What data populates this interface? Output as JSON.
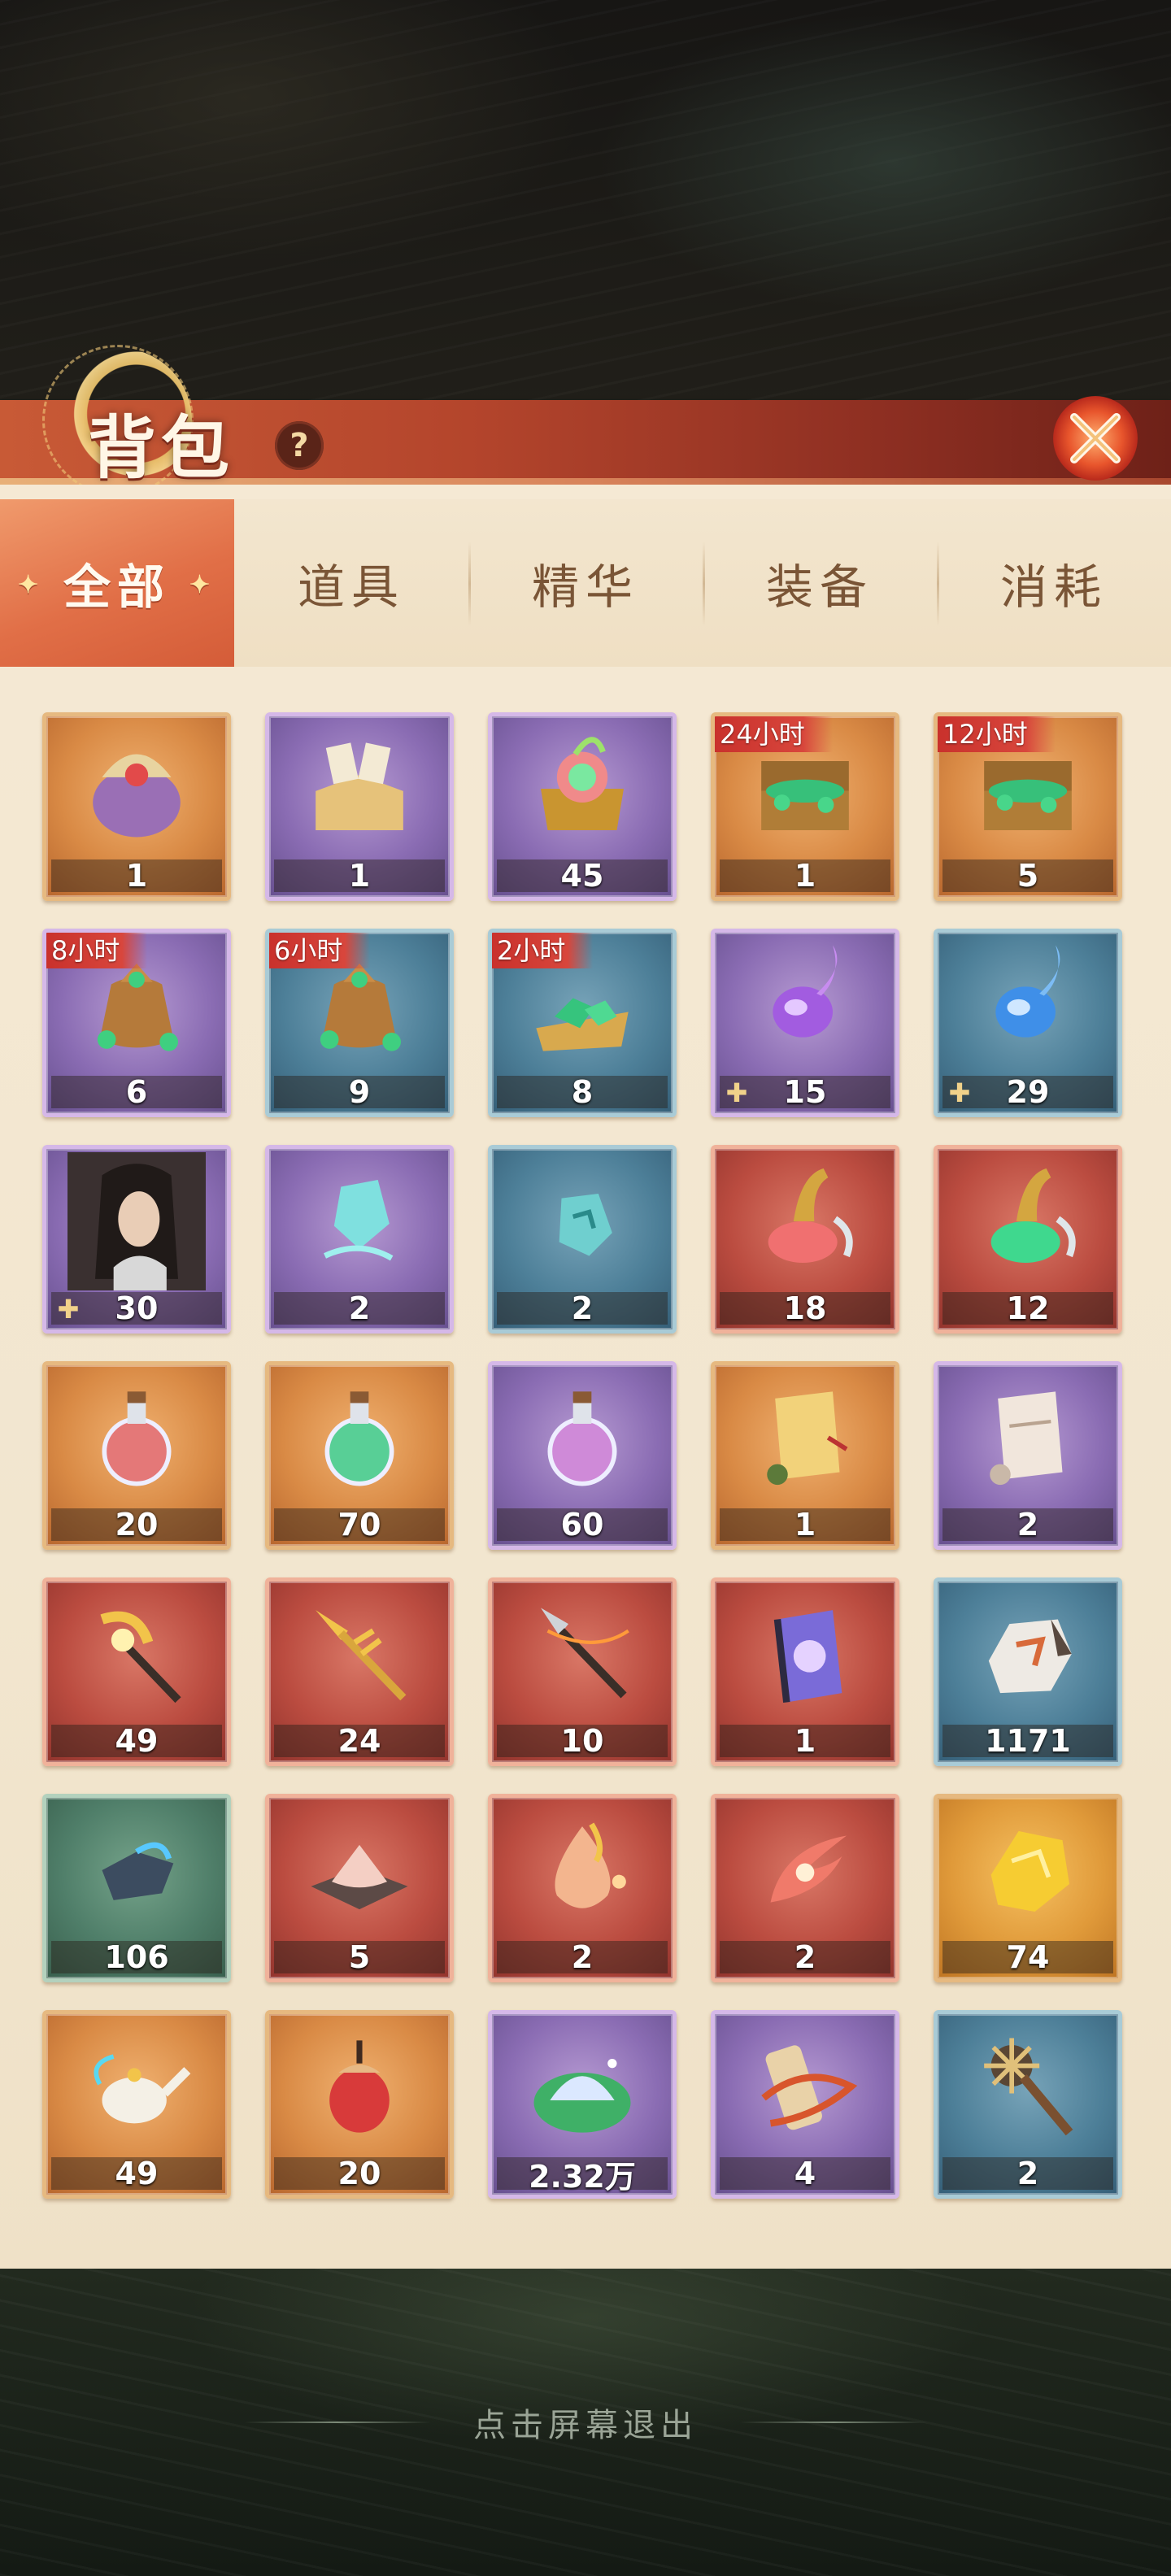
{
  "header": {
    "title": "背包",
    "help_icon": "?",
    "close_icon": "close-icon"
  },
  "tabs": [
    {
      "label": "全部",
      "active": true
    },
    {
      "label": "道具",
      "active": false
    },
    {
      "label": "精华",
      "active": false
    },
    {
      "label": "装备",
      "active": false
    },
    {
      "label": "消耗",
      "active": false
    }
  ],
  "items": [
    {
      "icon": "gift-bag-icon",
      "quality": "orange",
      "count": "1",
      "timer": ""
    },
    {
      "icon": "open-box-icon",
      "quality": "purple",
      "count": "1",
      "timer": ""
    },
    {
      "icon": "glowing-chest-icon",
      "quality": "purple",
      "count": "45",
      "timer": ""
    },
    {
      "icon": "jade-treasure-chest-icon",
      "quality": "orange",
      "count": "1",
      "timer": "24小时"
    },
    {
      "icon": "jade-treasure-chest-icon",
      "quality": "orange",
      "count": "5",
      "timer": "12小时"
    },
    {
      "icon": "jade-money-bag-icon",
      "quality": "purple",
      "count": "6",
      "timer": "8小时"
    },
    {
      "icon": "jade-money-bag-icon",
      "quality": "blue",
      "count": "9",
      "timer": "6小时"
    },
    {
      "icon": "jade-pile-icon",
      "quality": "blue",
      "count": "8",
      "timer": "2小时"
    },
    {
      "icon": "purple-soul-flame-icon",
      "quality": "purple",
      "count": "15",
      "timer": "",
      "fragment": true
    },
    {
      "icon": "blue-soul-flame-icon",
      "quality": "blue",
      "count": "29",
      "timer": "",
      "fragment": true
    },
    {
      "icon": "character-portrait-icon",
      "quality": "purple",
      "count": "30",
      "timer": "",
      "fragment": true
    },
    {
      "icon": "cyan-crystal-icon",
      "quality": "purple",
      "count": "2",
      "timer": ""
    },
    {
      "icon": "cyan-stone-icon",
      "quality": "blue",
      "count": "2",
      "timer": ""
    },
    {
      "icon": "red-elixir-gourd-icon",
      "quality": "red",
      "count": "18",
      "timer": ""
    },
    {
      "icon": "green-elixir-gourd-icon",
      "quality": "red",
      "count": "12",
      "timer": ""
    },
    {
      "icon": "red-potion-icon",
      "quality": "orange",
      "count": "20",
      "timer": ""
    },
    {
      "icon": "green-potion-icon",
      "quality": "orange",
      "count": "70",
      "timer": ""
    },
    {
      "icon": "purple-potion-icon",
      "quality": "purple",
      "count": "60",
      "timer": ""
    },
    {
      "icon": "golden-scroll-icon",
      "quality": "orange",
      "count": "1",
      "timer": ""
    },
    {
      "icon": "silver-scroll-icon",
      "quality": "purple",
      "count": "2",
      "timer": ""
    },
    {
      "icon": "golden-crescent-spear-icon",
      "quality": "red",
      "count": "49",
      "timer": ""
    },
    {
      "icon": "golden-halberd-icon",
      "quality": "red",
      "count": "24",
      "timer": ""
    },
    {
      "icon": "dark-spear-icon",
      "quality": "red",
      "count": "10",
      "timer": ""
    },
    {
      "icon": "lotus-talisman-icon",
      "quality": "red",
      "count": "1",
      "timer": ""
    },
    {
      "icon": "ore-stone-icon",
      "quality": "blue",
      "count": "1171",
      "timer": ""
    },
    {
      "icon": "dark-gem-icon",
      "quality": "green",
      "count": "106",
      "timer": ""
    },
    {
      "icon": "salt-tray-icon",
      "quality": "red",
      "count": "5",
      "timer": ""
    },
    {
      "icon": "flame-drop-icon",
      "quality": "red",
      "count": "2",
      "timer": ""
    },
    {
      "icon": "phoenix-feather-icon",
      "quality": "red",
      "count": "2",
      "timer": ""
    },
    {
      "icon": "gold-ore-icon",
      "quality": "gold",
      "count": "74",
      "timer": ""
    },
    {
      "icon": "magic-teapot-icon",
      "quality": "orange",
      "count": "49",
      "timer": ""
    },
    {
      "icon": "red-flower-bud-icon",
      "quality": "orange",
      "count": "20",
      "timer": ""
    },
    {
      "icon": "crystal-sand-leaf-icon",
      "quality": "purple",
      "count": "2.32万",
      "timer": ""
    },
    {
      "icon": "ribbon-scroll-icon",
      "quality": "purple",
      "count": "4",
      "timer": ""
    },
    {
      "icon": "spiked-mace-icon",
      "quality": "blue",
      "count": "2",
      "timer": ""
    }
  ],
  "footer": {
    "exit_hint": "点击屏幕退出"
  }
}
